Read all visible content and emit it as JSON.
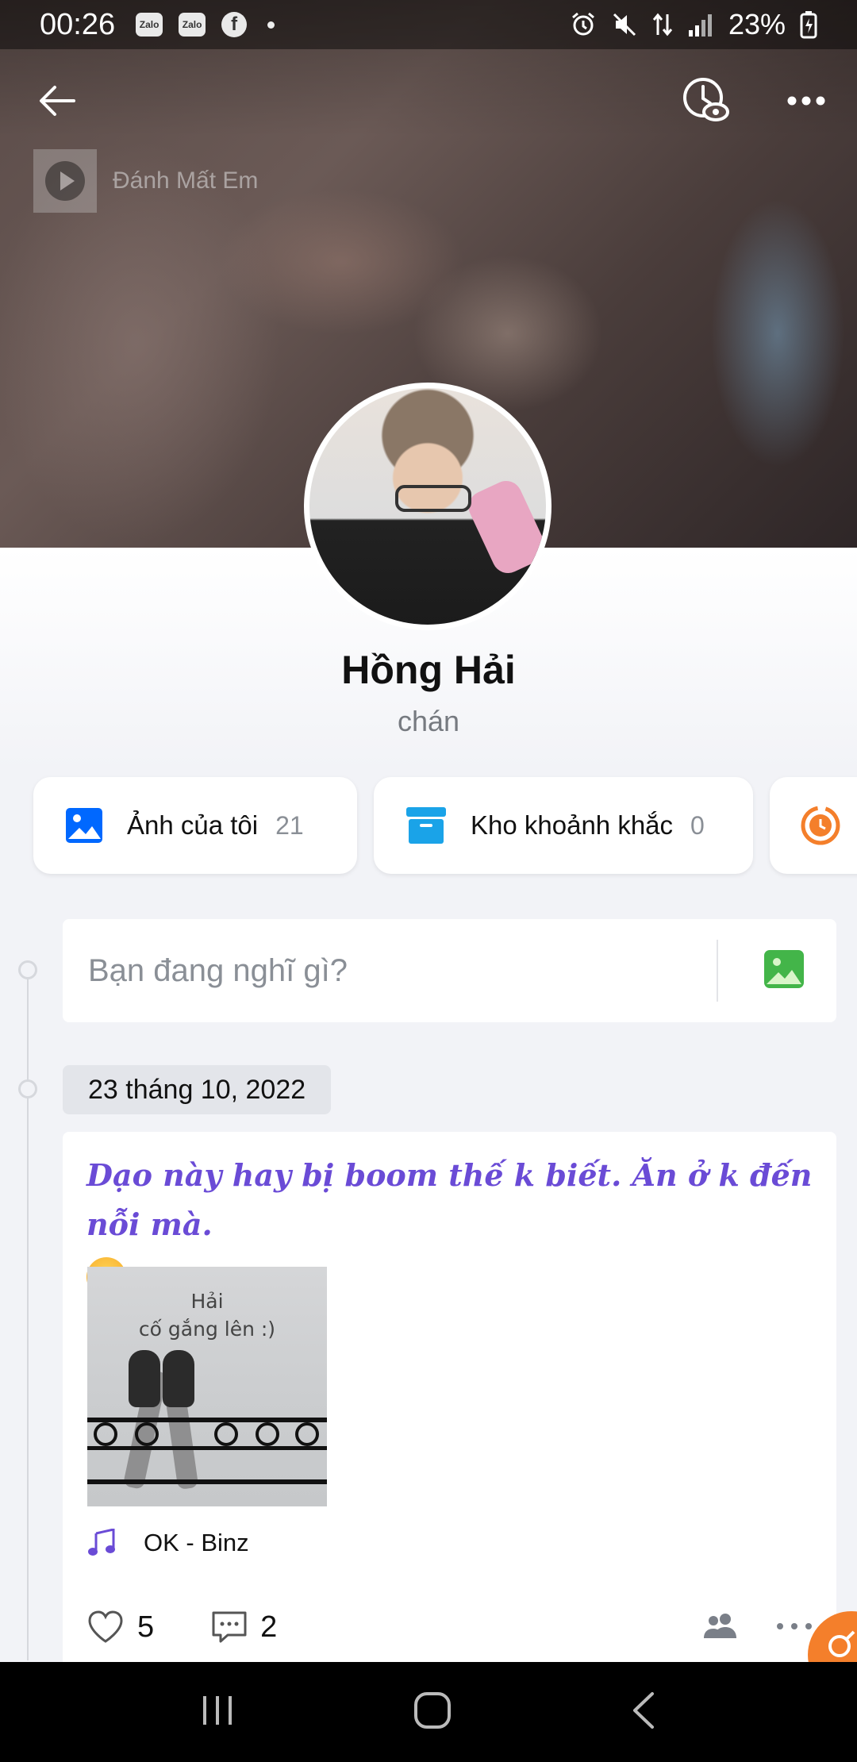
{
  "status_bar": {
    "time": "00:26",
    "notification_icons": [
      "Zalo",
      "Zalo",
      "f"
    ],
    "battery": "23%"
  },
  "cover": {
    "music_title": "Đánh Mất Em"
  },
  "profile": {
    "name": "Hồng Hải",
    "status": "chán"
  },
  "shortcuts": [
    {
      "label": "Ảnh của tôi",
      "count": "21",
      "icon": "image-icon",
      "color": "#0068ff"
    },
    {
      "label": "Kho khoảnh khắc",
      "count": "0",
      "icon": "archive-icon",
      "color": "#1aa3e8"
    },
    {
      "label": "",
      "count": "",
      "icon": "timer-icon",
      "color": "#f47f2b"
    }
  ],
  "composer": {
    "placeholder": "Bạn đang nghĩ gì?"
  },
  "timeline": {
    "date": "23 tháng 10, 2022"
  },
  "post": {
    "text": "Dạo này hay bị boom thế k biết. Ăn ở k đến nỗi mà.",
    "image_caption_line1": "Hải",
    "image_caption_line2": "cố gắng lên :)",
    "music": "OK - Binz",
    "likes": "5",
    "comments": "2",
    "accent_color": "#6a4bd6"
  }
}
